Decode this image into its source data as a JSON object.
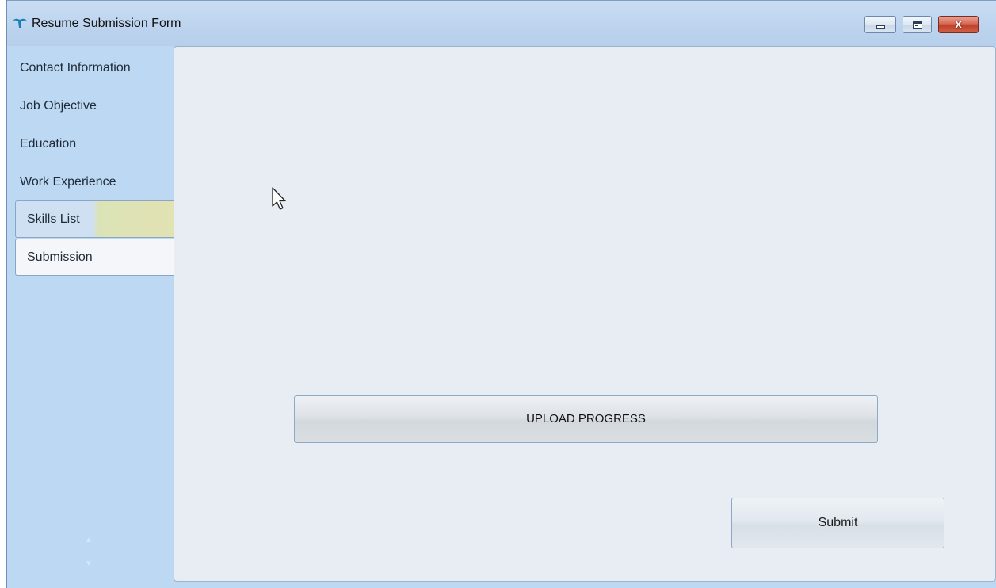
{
  "window": {
    "title": "Resume Submission Form",
    "caption_buttons": [
      "minimize",
      "maximize",
      "close"
    ],
    "close_glyph": "x"
  },
  "sidebar": {
    "items": [
      {
        "label": "Contact Information",
        "selected": false
      },
      {
        "label": "Job Objective",
        "selected": false
      },
      {
        "label": "Education",
        "selected": false
      },
      {
        "label": "Work Experience",
        "selected": false
      },
      {
        "label": "Skills List",
        "selected": false
      },
      {
        "label": "Submission",
        "selected": true
      }
    ]
  },
  "main": {
    "upload_progress": {
      "label": "UPLOAD PROGRESS",
      "progress": 0
    },
    "submit_label": "Submit"
  },
  "colors": {
    "window_bg": "#bcd8f3",
    "panel_bg": "#e7edf2",
    "close_button": "#c0402a"
  },
  "icons": [
    "app-logo-icon",
    "minimize-icon",
    "maximize-icon",
    "close-icon",
    "mouse-cursor-icon"
  ]
}
